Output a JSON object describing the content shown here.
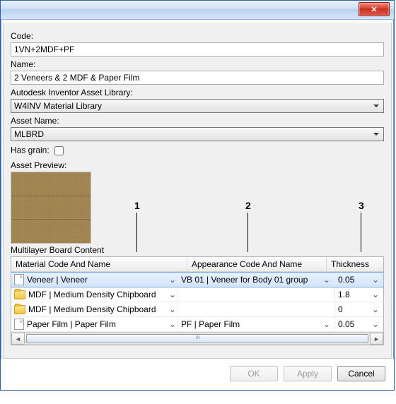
{
  "labels": {
    "code": "Code:",
    "name": "Name:",
    "library": "Autodesk Inventor Asset Library:",
    "assetName": "Asset Name:",
    "hasGrain": "Has grain:",
    "assetPreview": "Asset Preview:",
    "mlContent": "Multilayer Board Content"
  },
  "values": {
    "code": "1VN+2MDF+PF",
    "name": "2 Veneers & 2 MDF & Paper Film",
    "library": "W4INV Material Library",
    "assetName": "MLBRD",
    "hasGrain": false
  },
  "annotations": {
    "a1": "1",
    "a2": "2",
    "a3": "3"
  },
  "grid": {
    "headers": {
      "material": "Material Code And Name",
      "appearance": "Appearance Code And Name",
      "thickness": "Thickness"
    },
    "rows": [
      {
        "icon": "doc",
        "material": "Veneer | Veneer",
        "appearance": "VB 01 | Veneer for Body 01 group",
        "thickness": "0.05",
        "selected": true
      },
      {
        "icon": "folder",
        "material": "MDF | Medium Density Chipboard",
        "appearance": "",
        "thickness": "1.8",
        "selected": false
      },
      {
        "icon": "folder",
        "material": "MDF | Medium Density Chipboard",
        "appearance": "",
        "thickness": "0",
        "selected": false
      },
      {
        "icon": "doc",
        "material": "Paper Film | Paper Film",
        "appearance": "PF | Paper Film",
        "thickness": "0.05",
        "selected": false
      }
    ]
  },
  "buttons": {
    "ok": "OK",
    "apply": "Apply",
    "cancel": "Cancel"
  },
  "glyphs": {
    "close": "✕",
    "dd": "⌄",
    "left": "◄",
    "right": "►"
  }
}
